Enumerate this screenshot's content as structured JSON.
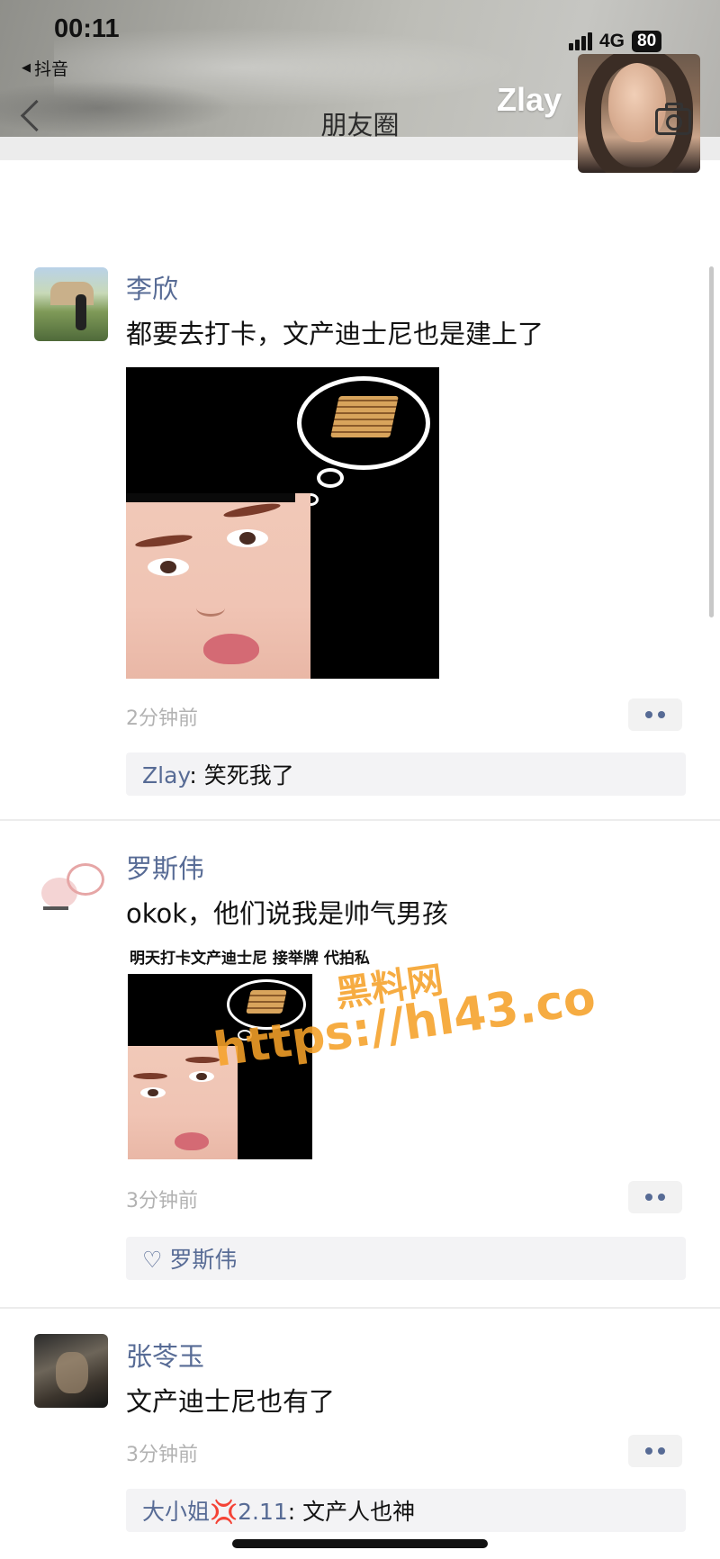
{
  "status_bar": {
    "time": "00:11",
    "back_app": "抖音",
    "network": "4G",
    "battery": "80"
  },
  "nav": {
    "title": "朋友圈",
    "profile_name": "Zlay"
  },
  "posts": [
    {
      "name": "李欣",
      "text": "都要去打卡，文产迪士尼也是建上了",
      "time": "2分钟前",
      "comment": {
        "author": "Zlay",
        "separator": ": ",
        "text": "笑死我了"
      }
    },
    {
      "name": "罗斯伟",
      "text": "okok，他们说我是帅气男孩",
      "image_caption": "明天打卡文产迪士尼 接举牌 代拍私",
      "time": "3分钟前",
      "likes": [
        "罗斯伟"
      ]
    },
    {
      "name": "张苓玉",
      "text": "文产迪士尼也有了",
      "time": "3分钟前",
      "comment": {
        "author": "大小姐💢2.11",
        "separator": ": ",
        "text": "文产人也神"
      }
    }
  ],
  "watermark": {
    "line1": "黑料网",
    "line2": "https://hl43.co"
  },
  "colors": {
    "link_blue": "#576b95",
    "time_gray": "#b2b2b2",
    "watermark_orange": "#f5a028"
  }
}
